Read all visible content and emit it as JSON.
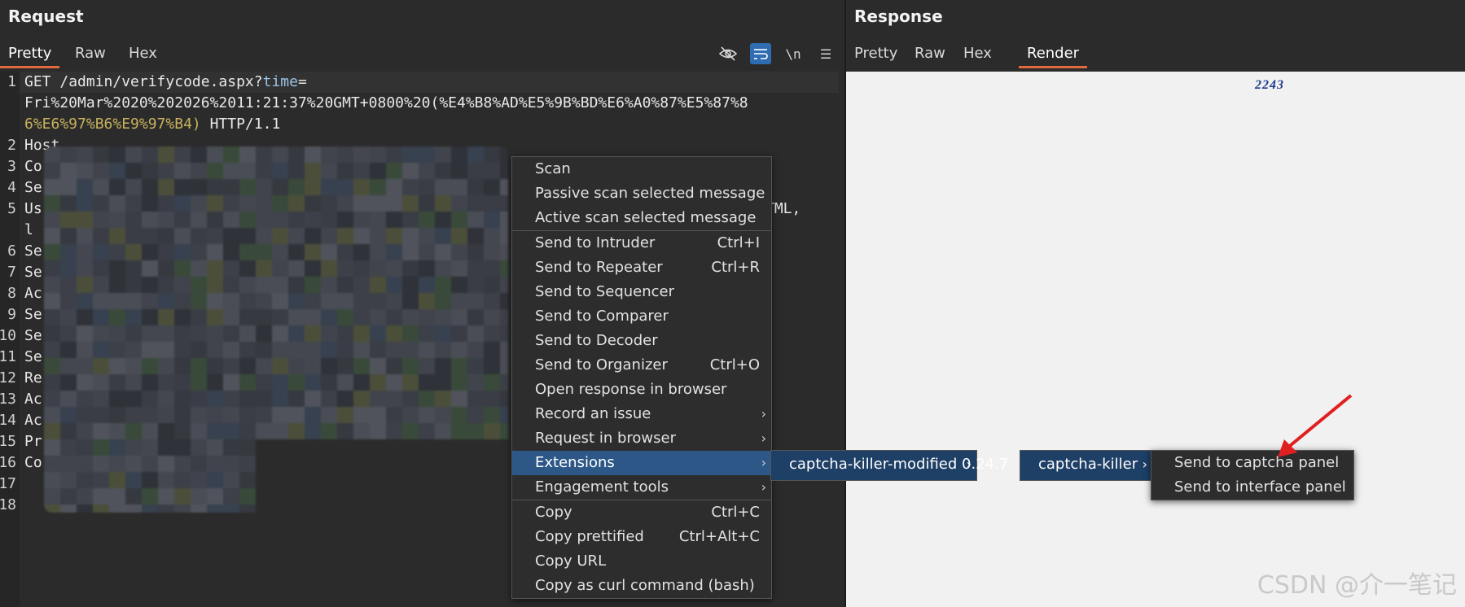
{
  "request": {
    "title": "Request",
    "tabs": [
      "Pretty",
      "Raw",
      "Hex"
    ],
    "active_tab": "Pretty",
    "tools": [
      {
        "icon": "eye-off-icon",
        "glyph": "◌"
      },
      {
        "icon": "wrap-icon",
        "glyph": "↵"
      },
      {
        "icon": "newline-icon",
        "glyph": "\\n"
      },
      {
        "icon": "menu-icon",
        "glyph": "☰"
      }
    ],
    "line_numbers": [
      "1",
      "",
      "",
      "2",
      "3",
      "4",
      "5",
      "",
      "6",
      "7",
      "8",
      "9",
      "10",
      "11",
      "12",
      "13",
      "14",
      "15",
      "16",
      "17",
      "18"
    ],
    "line1_method": "GET",
    "line1_path": " /admin/verifycode.aspx?",
    "line1_param": "time",
    "line1_eq": "=",
    "line1_value_a": "Fri%20Mar%2020%202026%2011:21:37%20GMT+0800%20(%E4%B8%AD%E5%9B%BD%E6%A0%87%E5%87%8",
    "line1_value_b": "6%E6%97%B6%E9%97%B4)",
    "line1_proto": " HTTP/1.1",
    "line2": "Host",
    "line3": "Co",
    "line4": "Se",
    "line5": "Us",
    "line5_tail": "TML,",
    "line5b": "l",
    "line6": "Se",
    "line7": "Se",
    "line8": "Ac",
    "line9": "Se",
    "line10": "Se",
    "line11": "Se",
    "line12": "Re",
    "line13": "Ac",
    "line14": "Ac",
    "line15": "Pr",
    "line16": "Co"
  },
  "response": {
    "title": "Response",
    "tabs": [
      "Pretty",
      "Raw",
      "Hex",
      "Render"
    ],
    "active_tab": "Render",
    "captcha_text": "2243",
    "watermark": "CSDN @介一笔记"
  },
  "context_menu": {
    "items": [
      {
        "label": "Scan"
      },
      {
        "label": "Passive scan selected message"
      },
      {
        "label": "Active scan selected message",
        "sep_after": true
      },
      {
        "label": "Send to Intruder",
        "shortcut": "Ctrl+I"
      },
      {
        "label": "Send to Repeater",
        "shortcut": "Ctrl+R"
      },
      {
        "label": "Send to Sequencer"
      },
      {
        "label": "Send to Comparer"
      },
      {
        "label": "Send to Decoder"
      },
      {
        "label": "Send to Organizer",
        "shortcut": "Ctrl+O"
      },
      {
        "label": "Open response in browser"
      },
      {
        "label": "Record an issue",
        "submenu": true
      },
      {
        "label": "Request in browser",
        "submenu": true
      },
      {
        "label": "Extensions",
        "submenu": true,
        "highlight": true
      },
      {
        "label": "Engagement tools",
        "submenu": true,
        "sep_after": true
      },
      {
        "label": "Copy",
        "shortcut": "Ctrl+C"
      },
      {
        "label": "Copy prettified",
        "shortcut": "Ctrl+Alt+C"
      },
      {
        "label": "Copy URL"
      },
      {
        "label": "Copy as curl command (bash)"
      }
    ]
  },
  "submenu_extensions": {
    "label": "captcha-killer-modified 0.24.7"
  },
  "submenu_captcha_killer": {
    "label": "captcha-killer"
  },
  "submenu_send": {
    "items": [
      {
        "label": "Send to captcha panel"
      },
      {
        "label": "Send to interface panel"
      }
    ]
  },
  "colors": {
    "accent": "#e2693e",
    "menu_highlight": "#2c5787",
    "arrow": "#e02020"
  }
}
